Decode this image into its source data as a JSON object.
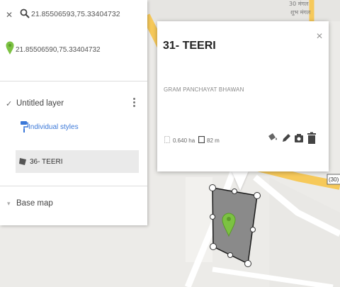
{
  "map": {
    "poi_top_label": "शुभ मंगल",
    "road_shield": "(30)",
    "top_label_top": "30 मंगल"
  },
  "search": {
    "coordinates": "21.85506593,75.33404732"
  },
  "result": {
    "coordinates": "21.85506590,75.33404732"
  },
  "layer": {
    "name": "Untitled layer",
    "style_link": "Individual styles",
    "feature_label": "36- TEERI"
  },
  "base_map": {
    "label": "Base map"
  },
  "popup": {
    "title": "31- TEERI",
    "description": "GRAM PANCHAYAT BHAWAN",
    "area": "0.640 ha",
    "length": "82 m"
  },
  "colors": {
    "pin": "#7cc242",
    "polygon_fill": "#8a8a8a",
    "road": "#f6c95a",
    "link": "#3b78d8"
  }
}
